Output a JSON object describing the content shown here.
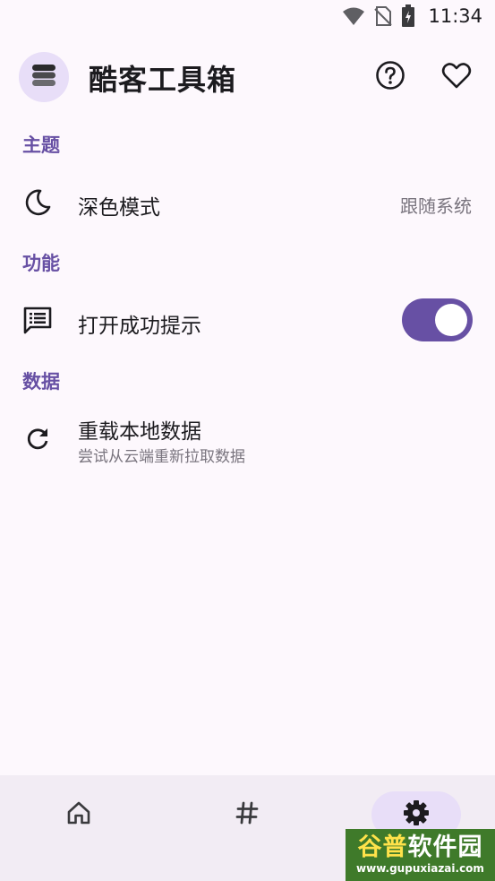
{
  "status_bar": {
    "time": "11:34",
    "icons": [
      "wifi-icon",
      "no-sim-icon",
      "battery-charging-icon"
    ]
  },
  "app_bar": {
    "title": "酷客工具箱",
    "logo_icon": "stack-layers-icon",
    "actions": [
      "help-icon",
      "heart-icon"
    ]
  },
  "sections": {
    "theme": {
      "title": "主题",
      "dark_mode": {
        "label": "深色模式",
        "value": "跟随系统",
        "icon": "moon-icon"
      }
    },
    "features": {
      "title": "功能",
      "open_success_tip": {
        "label": "打开成功提示",
        "icon": "message-list-icon",
        "enabled": true
      }
    },
    "data": {
      "title": "数据",
      "reload_local": {
        "label": "重载本地数据",
        "summary": "尝试从云端重新拉取数据",
        "icon": "refresh-icon"
      }
    }
  },
  "bottom_nav": {
    "items": [
      {
        "name": "home",
        "icon": "home-icon",
        "active": false
      },
      {
        "name": "tags",
        "icon": "hashtag-icon",
        "active": false
      },
      {
        "name": "settings",
        "icon": "gear-icon",
        "active": true
      }
    ]
  },
  "watermark": {
    "accent_text": "谷普",
    "main_text": "软件园",
    "url": "www.gupuxiazai.com"
  },
  "colors": {
    "accent": "#6750a4",
    "background": "#fdf8fd",
    "nav_background": "#f2ecf4",
    "indicator": "#e8def8"
  }
}
